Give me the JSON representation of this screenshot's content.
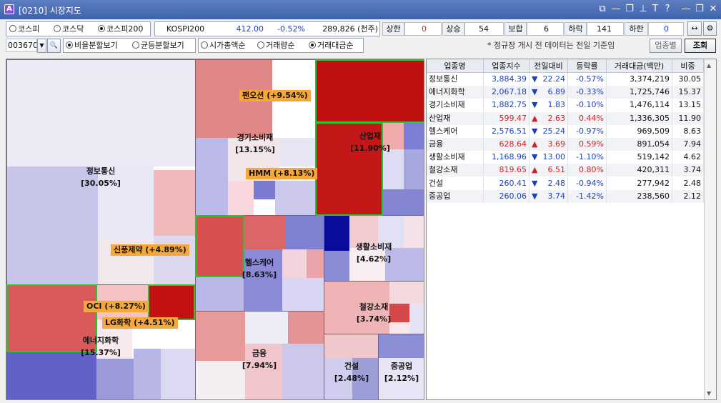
{
  "window": {
    "code": "[0210]",
    "title": "시장지도"
  },
  "icons": {
    "app": "A",
    "link": "⧉",
    "minimize": "—",
    "restore": "❐",
    "pin": "⊥",
    "font": "T",
    "help": "?",
    "close": "✕",
    "arrows": "↔",
    "gear": "⚙",
    "search": "🔍",
    "dropdown": "▼",
    "up": "▲",
    "down": "▼"
  },
  "market_radios": [
    {
      "label": "코스피",
      "selected": false
    },
    {
      "label": "코스닥",
      "selected": false
    },
    {
      "label": "코스피200",
      "selected": true
    }
  ],
  "index_box": {
    "name": "KOSPI200",
    "value": "412.00",
    "change": "-0.52%",
    "volume": "289,826 (천주)"
  },
  "stats": {
    "upper_label": "상한",
    "upper": "0",
    "rise_label": "상승",
    "rise": "54",
    "flat_label": "보합",
    "flat": "6",
    "fall_label": "하락",
    "fall": "141",
    "lower_label": "하한",
    "lower": "0"
  },
  "code_input": "003670",
  "split_radios": [
    {
      "label": "비율분할보기",
      "selected": true
    },
    {
      "label": "균등분할보기",
      "selected": false
    }
  ],
  "sort_radios": [
    {
      "label": "시가총액순",
      "selected": false
    },
    {
      "label": "거래량순",
      "selected": false
    },
    {
      "label": "거래대금순",
      "selected": true
    }
  ],
  "notice": "* 정규장 개시 전 데이터는 전일 기준임",
  "industry_button": "업종별",
  "query_button": "조회",
  "treemap": {
    "sectors": [
      {
        "name": "정보통신",
        "pct": "[30.05%]"
      },
      {
        "name": "경기소비재",
        "pct": "[13.15%]"
      },
      {
        "name": "산업재",
        "pct": "[11.90%]"
      },
      {
        "name": "헬스케어",
        "pct": "[8.63%]"
      },
      {
        "name": "생활소비재",
        "pct": "[4.62%]"
      },
      {
        "name": "에너지화학",
        "pct": "[15.37%]"
      },
      {
        "name": "철강소재",
        "pct": "[3.74%]"
      },
      {
        "name": "금융",
        "pct": "[7.94%]"
      },
      {
        "name": "건설",
        "pct": "[2.48%]"
      },
      {
        "name": "중공업",
        "pct": "[2.12%]"
      }
    ],
    "callouts": [
      "팬오션 (+9.54%)",
      "HMM (+8.13%)",
      "신풍제약 (+4.89%)",
      "OCI (+8.27%)",
      "LG화학 (+4.51%)"
    ]
  },
  "table": {
    "headers": [
      "업종명",
      "업종지수",
      "전일대비",
      "등락률",
      "거래대금(백만)",
      "비중"
    ],
    "rows": [
      {
        "name": "정보통신",
        "index": "3,884.39",
        "dir": "down",
        "change": "22.24",
        "rate": "-0.57%",
        "amount": "3,374,219",
        "weight": "30.05"
      },
      {
        "name": "에너지화학",
        "index": "2,067.18",
        "dir": "down",
        "change": "6.89",
        "rate": "-0.33%",
        "amount": "1,725,746",
        "weight": "15.37"
      },
      {
        "name": "경기소비재",
        "index": "1,882.75",
        "dir": "down",
        "change": "1.83",
        "rate": "-0.10%",
        "amount": "1,476,114",
        "weight": "13.15"
      },
      {
        "name": "산업재",
        "index": "599.47",
        "dir": "up",
        "change": "2.63",
        "rate": "0.44%",
        "amount": "1,336,305",
        "weight": "11.90"
      },
      {
        "name": "헬스케어",
        "index": "2,576.51",
        "dir": "down",
        "change": "25.24",
        "rate": "-0.97%",
        "amount": "969,509",
        "weight": "8.63"
      },
      {
        "name": "금융",
        "index": "628.64",
        "dir": "up",
        "change": "3.69",
        "rate": "0.59%",
        "amount": "891,054",
        "weight": "7.94"
      },
      {
        "name": "생활소비재",
        "index": "1,168.96",
        "dir": "down",
        "change": "13.00",
        "rate": "-1.10%",
        "amount": "519,142",
        "weight": "4.62"
      },
      {
        "name": "철강소재",
        "index": "819.65",
        "dir": "up",
        "change": "6.51",
        "rate": "0.80%",
        "amount": "420,311",
        "weight": "3.74"
      },
      {
        "name": "건설",
        "index": "260.41",
        "dir": "down",
        "change": "2.48",
        "rate": "-0.94%",
        "amount": "277,942",
        "weight": "2.48"
      },
      {
        "name": "중공업",
        "index": "260.06",
        "dir": "down",
        "change": "3.74",
        "rate": "-1.42%",
        "amount": "238,560",
        "weight": "2.12"
      }
    ]
  },
  "colors": {
    "up": "#d42020",
    "down": "#1a40c8",
    "callout": "#f4a83a",
    "highlight": "#2fc32f",
    "titlebar": "#4a6db5"
  }
}
